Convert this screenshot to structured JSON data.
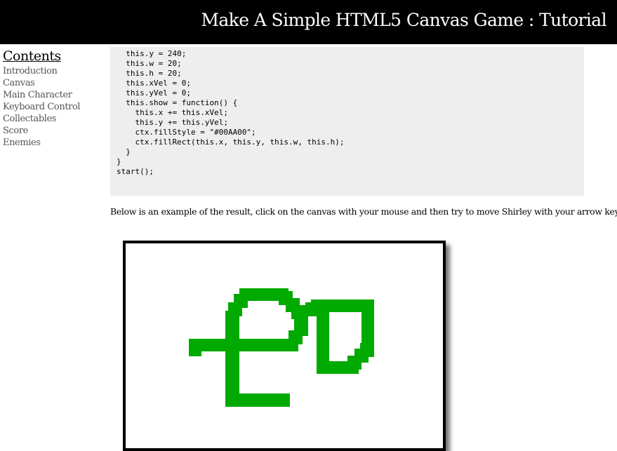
{
  "header": {
    "title": "Make A Simple HTML5 Canvas Game : Tutorial"
  },
  "sidebar": {
    "heading": "Contents",
    "items": [
      {
        "label": "Introduction"
      },
      {
        "label": "Canvas"
      },
      {
        "label": "Main Character"
      },
      {
        "label": "Keyboard Control"
      },
      {
        "label": "Collectables"
      },
      {
        "label": "Score"
      },
      {
        "label": "Enemies"
      }
    ]
  },
  "code": {
    "lines": [
      "  this.y = 240;",
      "  this.w = 20;",
      "  this.h = 20;",
      "  this.xVel = 0;",
      "  this.yVel = 0;",
      "  this.show = function() {",
      "    this.x += this.xVel;",
      "    this.y += this.yVel;",
      "    ctx.fillStyle = \"#00AA00\";",
      "    ctx.fillRect(this.x, this.y, this.w, this.h);",
      "  }",
      "}",
      "",
      "start();"
    ]
  },
  "main": {
    "description": "Below is an example of the result, click on the canvas with your mouse and then try to move Shirley with your arrow keys"
  },
  "canvas": {
    "trail_color": "#00AA00",
    "border_color": "#000000"
  }
}
